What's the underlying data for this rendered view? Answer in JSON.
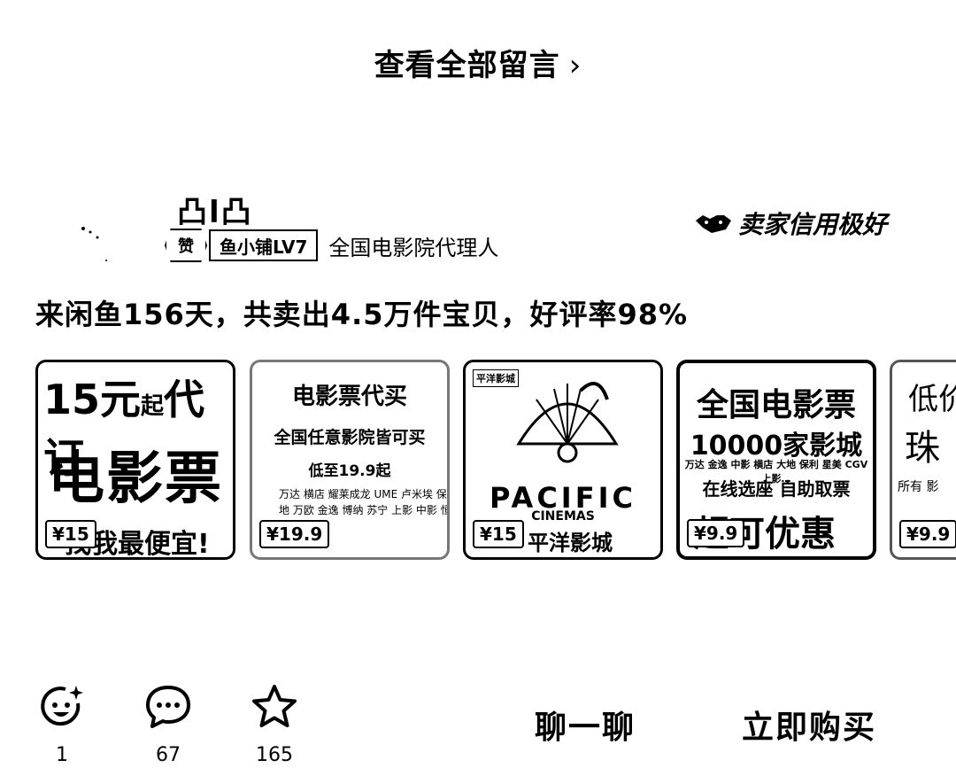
{
  "header": {
    "view_all_label": "查看全部留言",
    "chevron": "›"
  },
  "seller": {
    "name": "凸l凸",
    "badge_icon": "赞",
    "level_label": "鱼小铺LV7",
    "description": "全国电影院代理人",
    "credit_label": "卖家信用极好",
    "credit_icon": "handshake-icon",
    "stats": "来闲鱼156天，共卖出4.5万件宝贝，好评率98%"
  },
  "cards": [
    {
      "line1": "15元",
      "line1_small": "起",
      "line1b": "代订",
      "line2": "电影票",
      "line3": "找我最便宜!",
      "price": "¥15"
    },
    {
      "title": "电影票代买",
      "subtitle": "全国任意影院皆可买",
      "price_text": "低至19.9起",
      "cinemas": "万达 横店 耀莱成龙 UME 卢米埃 保利 大地 万欧 金逸 博纳 苏宁 上影 中影 恒大",
      "price": "¥19.9"
    },
    {
      "tag": "平洋影城",
      "brand": "PACIFIC",
      "brand_sub": "CINEMAS",
      "name": "平洋影城",
      "price": "¥15"
    },
    {
      "line1": "全国电影票",
      "line2": "10000家影城",
      "line3": "万达 金逸 中影 横店 大地 保利 星美 CGV 上影…",
      "line4": "在线选座 自助取票",
      "line5": "超可优惠",
      "price": "¥9.9"
    },
    {
      "line1": "低价",
      "line2": "珠",
      "line3": "所有 影",
      "price": "¥9.9"
    }
  ],
  "bottom_bar": {
    "like_count": "1",
    "comment_count": "67",
    "favorite_count": "165",
    "chat_label": "聊一聊",
    "buy_label": "立即购买"
  }
}
